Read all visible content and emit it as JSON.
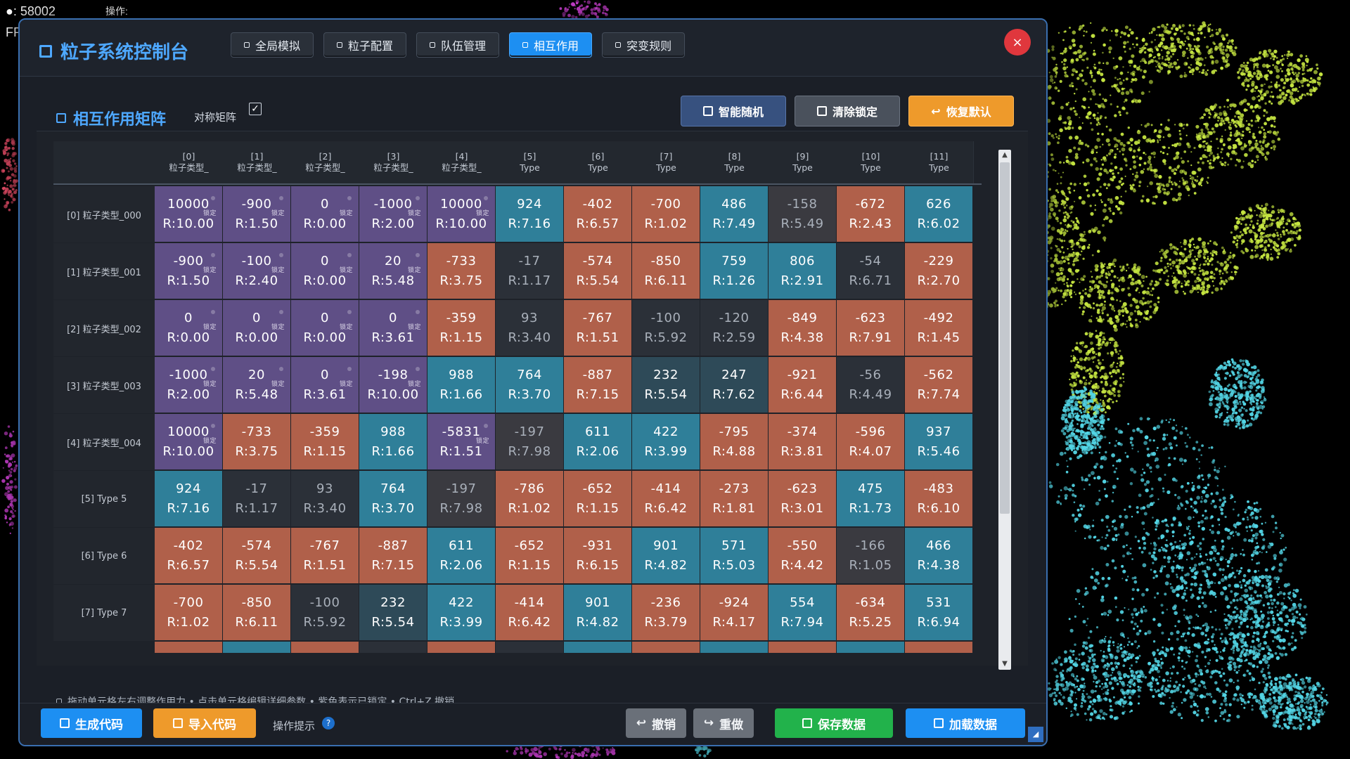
{
  "hud": {
    "count": "●: 58002",
    "op": "操作:",
    "fps": "FP"
  },
  "window": {
    "title": "粒子系统控制台",
    "tabs": [
      {
        "label": "全局模拟",
        "active": false
      },
      {
        "label": "粒子配置",
        "active": false
      },
      {
        "label": "队伍管理",
        "active": false
      },
      {
        "label": "相互作用",
        "active": true
      },
      {
        "label": "突变规则",
        "active": false
      }
    ],
    "close": "×"
  },
  "matrix_section": {
    "title": "相互作用矩阵",
    "symmetric_label": "对称矩阵",
    "symmetric_checked": "✓",
    "buttons": {
      "random": "智能随机",
      "clear": "清除锁定",
      "reset": "恢复默认",
      "reset_icon": "↩"
    },
    "lock_text": "锁定",
    "columns": [
      {
        "idx": "[0]",
        "name": "粒子类型_"
      },
      {
        "idx": "[1]",
        "name": "粒子类型_"
      },
      {
        "idx": "[2]",
        "name": "粒子类型_"
      },
      {
        "idx": "[3]",
        "name": "粒子类型_"
      },
      {
        "idx": "[4]",
        "name": "粒子类型_"
      },
      {
        "idx": "[5]",
        "name": "Type"
      },
      {
        "idx": "[6]",
        "name": "Type"
      },
      {
        "idx": "[7]",
        "name": "Type"
      },
      {
        "idx": "[8]",
        "name": "Type"
      },
      {
        "idx": "[9]",
        "name": "Type"
      },
      {
        "idx": "[10]",
        "name": "Type"
      },
      {
        "idx": "[11]",
        "name": "Type"
      }
    ],
    "rows": [
      {
        "label": "[0] 粒子类型_000",
        "cells": [
          {
            "v": "10000",
            "r": "R:10.00",
            "t": "l"
          },
          {
            "v": "-900",
            "r": "R:1.50",
            "t": "l"
          },
          {
            "v": "0",
            "r": "R:0.00",
            "t": "l"
          },
          {
            "v": "-1000",
            "r": "R:2.00",
            "t": "l"
          },
          {
            "v": "10000",
            "r": "R:10.00",
            "t": "l"
          },
          {
            "v": "924",
            "r": "R:7.16",
            "t": "b"
          },
          {
            "v": "-402",
            "r": "R:6.57",
            "t": "o"
          },
          {
            "v": "-700",
            "r": "R:1.02",
            "t": "o"
          },
          {
            "v": "486",
            "r": "R:7.49",
            "t": "b"
          },
          {
            "v": "-158",
            "r": "R:5.49",
            "t": "d"
          },
          {
            "v": "-672",
            "r": "R:2.43",
            "t": "o"
          },
          {
            "v": "626",
            "r": "R:6.02",
            "t": "b"
          }
        ]
      },
      {
        "label": "[1] 粒子类型_001",
        "cells": [
          {
            "v": "-900",
            "r": "R:1.50",
            "t": "l"
          },
          {
            "v": "-100",
            "r": "R:2.40",
            "t": "l"
          },
          {
            "v": "0",
            "r": "R:0.00",
            "t": "l"
          },
          {
            "v": "20",
            "r": "R:5.48",
            "t": "l"
          },
          {
            "v": "-733",
            "r": "R:3.75",
            "t": "o"
          },
          {
            "v": "-17",
            "r": "R:1.17",
            "t": "g"
          },
          {
            "v": "-574",
            "r": "R:5.54",
            "t": "o"
          },
          {
            "v": "-850",
            "r": "R:6.11",
            "t": "o"
          },
          {
            "v": "759",
            "r": "R:1.26",
            "t": "b"
          },
          {
            "v": "806",
            "r": "R:2.91",
            "t": "b"
          },
          {
            "v": "-54",
            "r": "R:6.71",
            "t": "g"
          },
          {
            "v": "-229",
            "r": "R:2.70",
            "t": "o"
          }
        ]
      },
      {
        "label": "[2] 粒子类型_002",
        "cells": [
          {
            "v": "0",
            "r": "R:0.00",
            "t": "l"
          },
          {
            "v": "0",
            "r": "R:0.00",
            "t": "l"
          },
          {
            "v": "0",
            "r": "R:0.00",
            "t": "l"
          },
          {
            "v": "0",
            "r": "R:3.61",
            "t": "l"
          },
          {
            "v": "-359",
            "r": "R:1.15",
            "t": "o"
          },
          {
            "v": "93",
            "r": "R:3.40",
            "t": "g"
          },
          {
            "v": "-767",
            "r": "R:1.51",
            "t": "o"
          },
          {
            "v": "-100",
            "r": "R:5.92",
            "t": "g"
          },
          {
            "v": "-120",
            "r": "R:2.59",
            "t": "g"
          },
          {
            "v": "-849",
            "r": "R:4.38",
            "t": "o"
          },
          {
            "v": "-623",
            "r": "R:7.91",
            "t": "o"
          },
          {
            "v": "-492",
            "r": "R:1.45",
            "t": "o"
          }
        ]
      },
      {
        "label": "[3] 粒子类型_003",
        "cells": [
          {
            "v": "-1000",
            "r": "R:2.00",
            "t": "l"
          },
          {
            "v": "20",
            "r": "R:5.48",
            "t": "l"
          },
          {
            "v": "0",
            "r": "R:3.61",
            "t": "l"
          },
          {
            "v": "-198",
            "r": "R:10.00",
            "t": "l"
          },
          {
            "v": "988",
            "r": "R:1.66",
            "t": "b"
          },
          {
            "v": "764",
            "r": "R:3.70",
            "t": "b"
          },
          {
            "v": "-887",
            "r": "R:7.15",
            "t": "o"
          },
          {
            "v": "232",
            "r": "R:5.54",
            "t": "bd"
          },
          {
            "v": "247",
            "r": "R:7.62",
            "t": "bd"
          },
          {
            "v": "-921",
            "r": "R:6.44",
            "t": "o"
          },
          {
            "v": "-56",
            "r": "R:4.49",
            "t": "g"
          },
          {
            "v": "-562",
            "r": "R:7.74",
            "t": "o"
          }
        ]
      },
      {
        "label": "[4] 粒子类型_004",
        "cells": [
          {
            "v": "10000",
            "r": "R:10.00",
            "t": "l"
          },
          {
            "v": "-733",
            "r": "R:3.75",
            "t": "o"
          },
          {
            "v": "-359",
            "r": "R:1.15",
            "t": "o"
          },
          {
            "v": "988",
            "r": "R:1.66",
            "t": "b"
          },
          {
            "v": "-5831",
            "r": "R:1.51",
            "t": "l"
          },
          {
            "v": "-197",
            "r": "R:7.98",
            "t": "d"
          },
          {
            "v": "611",
            "r": "R:2.06",
            "t": "b"
          },
          {
            "v": "422",
            "r": "R:3.99",
            "t": "b"
          },
          {
            "v": "-795",
            "r": "R:4.88",
            "t": "o"
          },
          {
            "v": "-374",
            "r": "R:3.81",
            "t": "o"
          },
          {
            "v": "-596",
            "r": "R:4.07",
            "t": "o"
          },
          {
            "v": "937",
            "r": "R:5.46",
            "t": "b"
          }
        ]
      },
      {
        "label": "[5] Type 5",
        "cells": [
          {
            "v": "924",
            "r": "R:7.16",
            "t": "b"
          },
          {
            "v": "-17",
            "r": "R:1.17",
            "t": "g"
          },
          {
            "v": "93",
            "r": "R:3.40",
            "t": "g"
          },
          {
            "v": "764",
            "r": "R:3.70",
            "t": "b"
          },
          {
            "v": "-197",
            "r": "R:7.98",
            "t": "d"
          },
          {
            "v": "-786",
            "r": "R:1.02",
            "t": "o"
          },
          {
            "v": "-652",
            "r": "R:1.15",
            "t": "o"
          },
          {
            "v": "-414",
            "r": "R:6.42",
            "t": "o"
          },
          {
            "v": "-273",
            "r": "R:1.81",
            "t": "o"
          },
          {
            "v": "-623",
            "r": "R:3.01",
            "t": "o"
          },
          {
            "v": "475",
            "r": "R:1.73",
            "t": "b"
          },
          {
            "v": "-483",
            "r": "R:6.10",
            "t": "o"
          }
        ]
      },
      {
        "label": "[6] Type 6",
        "cells": [
          {
            "v": "-402",
            "r": "R:6.57",
            "t": "o"
          },
          {
            "v": "-574",
            "r": "R:5.54",
            "t": "o"
          },
          {
            "v": "-767",
            "r": "R:1.51",
            "t": "o"
          },
          {
            "v": "-887",
            "r": "R:7.15",
            "t": "o"
          },
          {
            "v": "611",
            "r": "R:2.06",
            "t": "b"
          },
          {
            "v": "-652",
            "r": "R:1.15",
            "t": "o"
          },
          {
            "v": "-931",
            "r": "R:6.15",
            "t": "o"
          },
          {
            "v": "901",
            "r": "R:4.82",
            "t": "b"
          },
          {
            "v": "571",
            "r": "R:5.03",
            "t": "b"
          },
          {
            "v": "-550",
            "r": "R:4.42",
            "t": "o"
          },
          {
            "v": "-166",
            "r": "R:1.05",
            "t": "d"
          },
          {
            "v": "466",
            "r": "R:4.38",
            "t": "b"
          }
        ]
      },
      {
        "label": "[7] Type 7",
        "cells": [
          {
            "v": "-700",
            "r": "R:1.02",
            "t": "o"
          },
          {
            "v": "-850",
            "r": "R:6.11",
            "t": "o"
          },
          {
            "v": "-100",
            "r": "R:5.92",
            "t": "g"
          },
          {
            "v": "232",
            "r": "R:5.54",
            "t": "bd"
          },
          {
            "v": "422",
            "r": "R:3.99",
            "t": "b"
          },
          {
            "v": "-414",
            "r": "R:6.42",
            "t": "o"
          },
          {
            "v": "901",
            "r": "R:4.82",
            "t": "b"
          },
          {
            "v": "-236",
            "r": "R:3.79",
            "t": "o"
          },
          {
            "v": "-924",
            "r": "R:4.17",
            "t": "o"
          },
          {
            "v": "554",
            "r": "R:7.94",
            "t": "b"
          },
          {
            "v": "-634",
            "r": "R:5.25",
            "t": "o"
          },
          {
            "v": "531",
            "r": "R:6.94",
            "t": "b"
          }
        ]
      }
    ],
    "hint": "拖动单元格左右调整作用力 • 点击单元格编辑详细参数 • 紫色表示已锁定 • Ctrl+Z 撤销"
  },
  "footer": {
    "generate": "生成代码",
    "import": "导入代码",
    "ops_hint": "操作提示",
    "help": "?",
    "undo": "撤销",
    "redo": "重做",
    "undo_icon": "↩",
    "redo_icon": "↪",
    "save": "保存数据",
    "load": "加载数据",
    "grip": "◢"
  },
  "colors": {
    "accent": "#4ea8ff",
    "locked": "#5f4f86",
    "attract": "#2f7f99",
    "repel": "#b0604a",
    "neutral": "#2b3038",
    "particle_yellow": "#c6e641",
    "particle_cyan": "#53d6e6",
    "particle_magenta": "#c93fcf"
  }
}
